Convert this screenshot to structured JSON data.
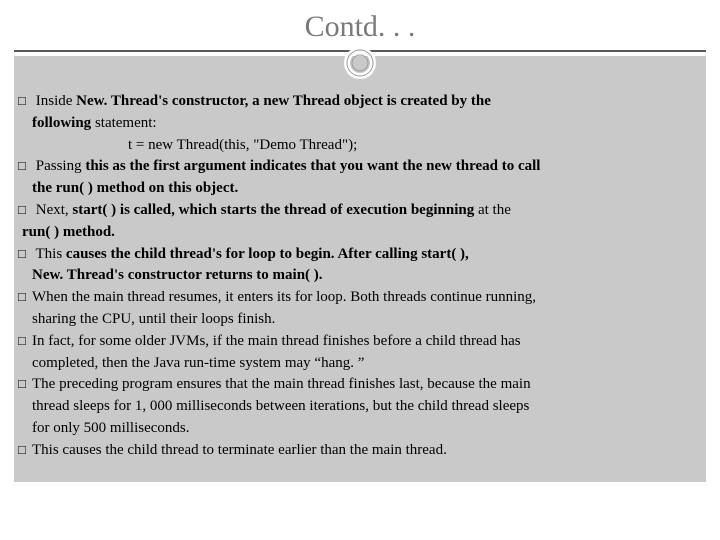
{
  "title": "Contd. . .",
  "code": "t = new Thread(this, \"Demo Thread\");",
  "bullets": [
    {
      "pre": "Inside ",
      "b1": "New. Thread's constructor, a new Thread object is created by the",
      "mid": "",
      "b2": "following ",
      "post": "statement:"
    },
    {
      "pre": "Passing ",
      "b1": "this as the first argument indicates that you want the new thread to call",
      "b2": "the run( ) method on this object."
    },
    {
      "pre": "Next, ",
      "b1": "start( ) is called, which starts the thread of execution beginning ",
      "post": "at the",
      "b2": "run( ) method."
    },
    {
      "pre": "This ",
      "b1": "causes the child thread's for loop to begin. After calling start( ),",
      "b2": "New. Thread's constructor returns to main( )."
    },
    {
      "line1": "When the main thread resumes, it enters its for loop. Both threads continue running,",
      "line2": "sharing the CPU, until their loops finish."
    },
    {
      "line1": "In fact, for some older JVMs, if the main thread finishes before a child thread has",
      "line2": "completed, then the Java run-time system may “hang. ”"
    },
    {
      "line1": "The preceding program ensures that the main thread finishes last, because the main",
      "line2": "thread sleeps for 1, 000 milliseconds between iterations, but the child thread sleeps",
      "line3": "for only 500 milliseconds."
    },
    {
      "line1": "This causes the child thread to terminate earlier than the main thread."
    }
  ]
}
